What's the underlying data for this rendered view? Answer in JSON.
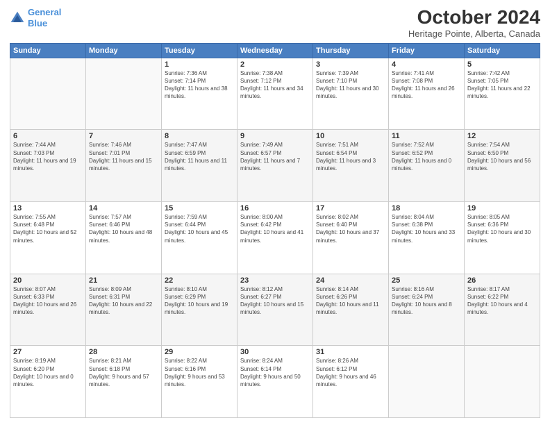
{
  "header": {
    "logo_line1": "General",
    "logo_line2": "Blue",
    "month_title": "October 2024",
    "location": "Heritage Pointe, Alberta, Canada"
  },
  "weekdays": [
    "Sunday",
    "Monday",
    "Tuesday",
    "Wednesday",
    "Thursday",
    "Friday",
    "Saturday"
  ],
  "weeks": [
    [
      {
        "day": "",
        "info": ""
      },
      {
        "day": "",
        "info": ""
      },
      {
        "day": "1",
        "info": "Sunrise: 7:36 AM\nSunset: 7:14 PM\nDaylight: 11 hours and 38 minutes."
      },
      {
        "day": "2",
        "info": "Sunrise: 7:38 AM\nSunset: 7:12 PM\nDaylight: 11 hours and 34 minutes."
      },
      {
        "day": "3",
        "info": "Sunrise: 7:39 AM\nSunset: 7:10 PM\nDaylight: 11 hours and 30 minutes."
      },
      {
        "day": "4",
        "info": "Sunrise: 7:41 AM\nSunset: 7:08 PM\nDaylight: 11 hours and 26 minutes."
      },
      {
        "day": "5",
        "info": "Sunrise: 7:42 AM\nSunset: 7:05 PM\nDaylight: 11 hours and 22 minutes."
      }
    ],
    [
      {
        "day": "6",
        "info": "Sunrise: 7:44 AM\nSunset: 7:03 PM\nDaylight: 11 hours and 19 minutes."
      },
      {
        "day": "7",
        "info": "Sunrise: 7:46 AM\nSunset: 7:01 PM\nDaylight: 11 hours and 15 minutes."
      },
      {
        "day": "8",
        "info": "Sunrise: 7:47 AM\nSunset: 6:59 PM\nDaylight: 11 hours and 11 minutes."
      },
      {
        "day": "9",
        "info": "Sunrise: 7:49 AM\nSunset: 6:57 PM\nDaylight: 11 hours and 7 minutes."
      },
      {
        "day": "10",
        "info": "Sunrise: 7:51 AM\nSunset: 6:54 PM\nDaylight: 11 hours and 3 minutes."
      },
      {
        "day": "11",
        "info": "Sunrise: 7:52 AM\nSunset: 6:52 PM\nDaylight: 11 hours and 0 minutes."
      },
      {
        "day": "12",
        "info": "Sunrise: 7:54 AM\nSunset: 6:50 PM\nDaylight: 10 hours and 56 minutes."
      }
    ],
    [
      {
        "day": "13",
        "info": "Sunrise: 7:55 AM\nSunset: 6:48 PM\nDaylight: 10 hours and 52 minutes."
      },
      {
        "day": "14",
        "info": "Sunrise: 7:57 AM\nSunset: 6:46 PM\nDaylight: 10 hours and 48 minutes."
      },
      {
        "day": "15",
        "info": "Sunrise: 7:59 AM\nSunset: 6:44 PM\nDaylight: 10 hours and 45 minutes."
      },
      {
        "day": "16",
        "info": "Sunrise: 8:00 AM\nSunset: 6:42 PM\nDaylight: 10 hours and 41 minutes."
      },
      {
        "day": "17",
        "info": "Sunrise: 8:02 AM\nSunset: 6:40 PM\nDaylight: 10 hours and 37 minutes."
      },
      {
        "day": "18",
        "info": "Sunrise: 8:04 AM\nSunset: 6:38 PM\nDaylight: 10 hours and 33 minutes."
      },
      {
        "day": "19",
        "info": "Sunrise: 8:05 AM\nSunset: 6:36 PM\nDaylight: 10 hours and 30 minutes."
      }
    ],
    [
      {
        "day": "20",
        "info": "Sunrise: 8:07 AM\nSunset: 6:33 PM\nDaylight: 10 hours and 26 minutes."
      },
      {
        "day": "21",
        "info": "Sunrise: 8:09 AM\nSunset: 6:31 PM\nDaylight: 10 hours and 22 minutes."
      },
      {
        "day": "22",
        "info": "Sunrise: 8:10 AM\nSunset: 6:29 PM\nDaylight: 10 hours and 19 minutes."
      },
      {
        "day": "23",
        "info": "Sunrise: 8:12 AM\nSunset: 6:27 PM\nDaylight: 10 hours and 15 minutes."
      },
      {
        "day": "24",
        "info": "Sunrise: 8:14 AM\nSunset: 6:26 PM\nDaylight: 10 hours and 11 minutes."
      },
      {
        "day": "25",
        "info": "Sunrise: 8:16 AM\nSunset: 6:24 PM\nDaylight: 10 hours and 8 minutes."
      },
      {
        "day": "26",
        "info": "Sunrise: 8:17 AM\nSunset: 6:22 PM\nDaylight: 10 hours and 4 minutes."
      }
    ],
    [
      {
        "day": "27",
        "info": "Sunrise: 8:19 AM\nSunset: 6:20 PM\nDaylight: 10 hours and 0 minutes."
      },
      {
        "day": "28",
        "info": "Sunrise: 8:21 AM\nSunset: 6:18 PM\nDaylight: 9 hours and 57 minutes."
      },
      {
        "day": "29",
        "info": "Sunrise: 8:22 AM\nSunset: 6:16 PM\nDaylight: 9 hours and 53 minutes."
      },
      {
        "day": "30",
        "info": "Sunrise: 8:24 AM\nSunset: 6:14 PM\nDaylight: 9 hours and 50 minutes."
      },
      {
        "day": "31",
        "info": "Sunrise: 8:26 AM\nSunset: 6:12 PM\nDaylight: 9 hours and 46 minutes."
      },
      {
        "day": "",
        "info": ""
      },
      {
        "day": "",
        "info": ""
      }
    ]
  ]
}
